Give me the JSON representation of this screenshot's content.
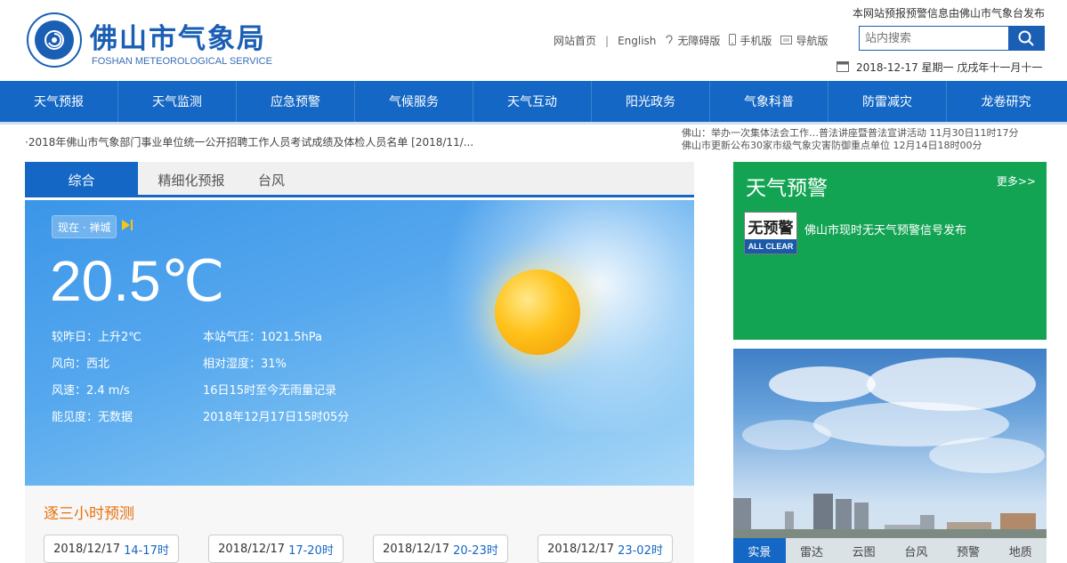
{
  "header": {
    "title": "佛山市气象局",
    "subtitle": "FOSHAN METEOROLOGICAL SERVICE",
    "notice": "本网站预报预警信息由佛山市气象台发布",
    "links": {
      "home": "网站首页",
      "sep": "|",
      "english": "English",
      "accessible": "无障碍版",
      "mobile": "手机版",
      "guide": "导航版"
    },
    "search_placeholder": "站内搜索",
    "date": "2018-12-17 星期一 戊戌年十一月十一"
  },
  "nav": [
    "天气预报",
    "天气监测",
    "应急预警",
    "气候服务",
    "天气互动",
    "阳光政务",
    "气象科普",
    "防雷减灾",
    "龙卷研究"
  ],
  "ticker": {
    "left": "·2018年佛山市气象部门事业单位统一公开招聘工作人员考试成绩及体检人员名单 [2018/11/...",
    "right_1": "佛山：举办一次集体法会工作…普法讲座暨普法宣讲活动 11月30日11时17分",
    "right_2": "佛山市更新公布30家市级气象灾害防御重点单位 12月14日18时00分"
  },
  "weather": {
    "tabs": [
      "综合",
      "精细化预报",
      "台风"
    ],
    "location": "现在 · 禅城",
    "temperature": "20.5℃",
    "left_info": [
      "较昨日：上升2℃",
      "风向：西北",
      "风速：2.4 m/s",
      "能见度：无数据"
    ],
    "right_info": [
      "本站气压：1021.5hPa",
      "相对湿度：31%",
      "16日15时至今无雨量记录",
      "2018年12月17日15时05分"
    ]
  },
  "forecast": {
    "title": "逐三小时预测",
    "items": [
      {
        "date": "2018/12/17",
        "hours": "14-17时"
      },
      {
        "date": "2018/12/17",
        "hours": "17-20时"
      },
      {
        "date": "2018/12/17",
        "hours": "20-23时"
      },
      {
        "date": "2018/12/17",
        "hours": "23-02时"
      }
    ]
  },
  "warning": {
    "title": "天气预警",
    "more": "更多>>",
    "icon_top": "无预警",
    "icon_bottom": "ALL CLEAR",
    "text": "佛山市现时无天气预警信号发布"
  },
  "photo_tabs": [
    "实景",
    "雷达",
    "云图",
    "台风",
    "预警",
    "地质"
  ],
  "colors": {
    "brand_blue": "#1467c4",
    "warning_green": "#13a453",
    "forecast_orange": "#e8700a"
  }
}
